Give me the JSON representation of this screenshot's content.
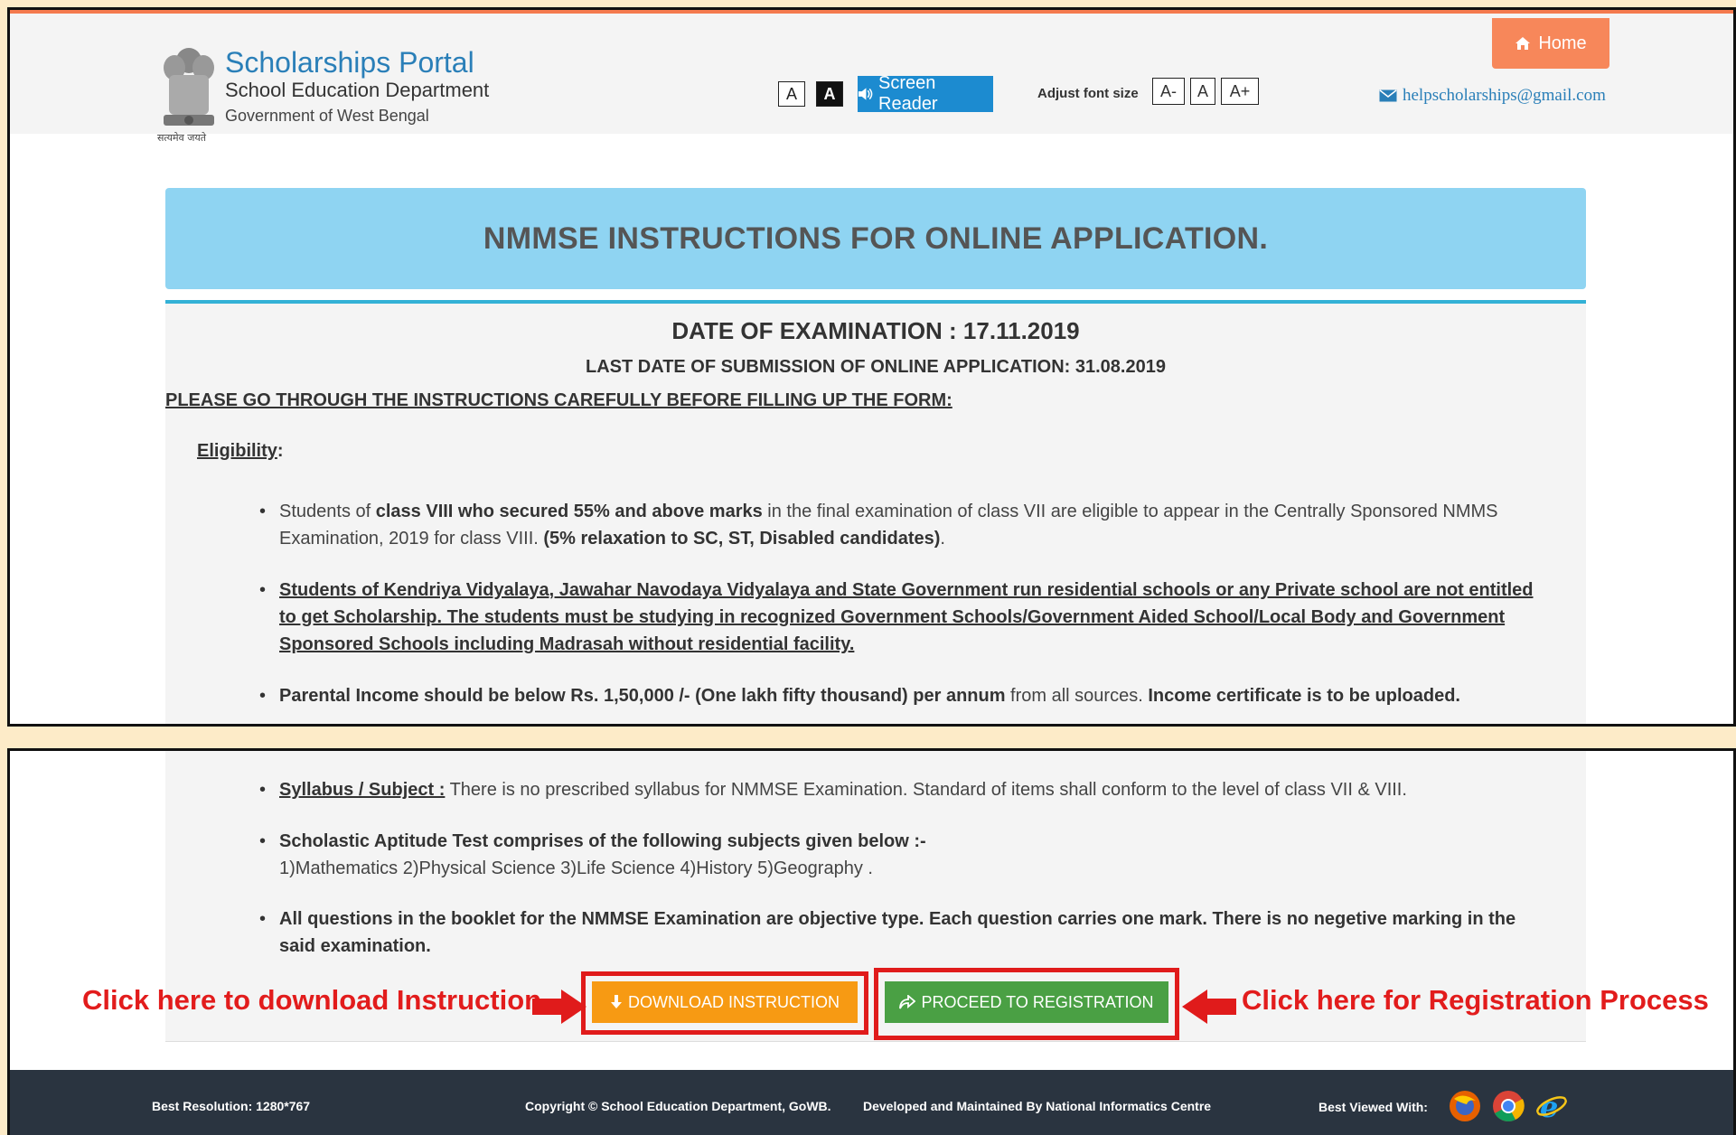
{
  "header": {
    "portal_title": "Scholarships Portal",
    "department": "School Education Department",
    "government": "Government of West Bengal",
    "motto": "सत्यमेव जयते",
    "contrast_normal": "A",
    "contrast_dark": "A",
    "screen_reader_label": "Screen Reader",
    "adjust_font_label": "Adjust font size",
    "font_decrease": "A-",
    "font_normal": "A",
    "font_increase": "A+",
    "home_label": "Home",
    "email": "helpscholarships@gmail.com"
  },
  "main": {
    "banner_title": "NMMSE INSTRUCTIONS FOR ONLINE APPLICATION.",
    "exam_date": "DATE OF EXAMINATION : 17.11.2019",
    "last_date": "LAST DATE OF SUBMISSION OF ONLINE APPLICATION: 31.08.2019",
    "please_read": "PLEASE GO THROUGH THE INSTRUCTIONS CAREFULLY BEFORE FILLING UP THE FORM:",
    "eligibility_label": "Eligibility",
    "eligibility_colon": ":",
    "bullet1": {
      "t1": "Students of ",
      "b1": "class VIII who secured 55% and above marks",
      "t2": " in the final examination of class VII are eligible to appear in the Centrally Sponsored NMMS Examination, 2019 for class VIII. ",
      "b2": "(5% relaxation to SC, ST, Disabled candidates)",
      "t3": "."
    },
    "bullet2": "Students of Kendriya Vidyalaya, Jawahar Navodaya Vidyalaya and State Government run residential schools or any Private school are not entitled to get Scholarship. The students must be studying in recognized Government Schools/Government Aided School/Local Body and Government Sponsored Schools including Madrasah without residential facility.",
    "bullet3": {
      "b1": "Parental Income should be below Rs. 1,50,000 /- (One lakh fifty thousand) per annum",
      "t1": " from all sources. ",
      "b2": "Income certificate is to be uploaded."
    },
    "bullet4": {
      "label": "Syllabus / Subject :",
      "text": " There is no prescribed syllabus for NMMSE Examination. Standard of items shall conform to the level of class VII & VIII."
    },
    "bullet5": {
      "bold": "Scholastic Aptitude Test comprises of the following subjects given below :-",
      "subjects": "1)Mathematics 2)Physical Science 3)Life Science 4)History 5)Geography ."
    },
    "bullet6": "All questions in the booklet for the NMMSE Examination are objective type. Each question carries one mark. There is no negetive marking in the said examination."
  },
  "actions": {
    "download_label": "DOWNLOAD INSTRUCTION",
    "register_label": "PROCEED TO REGISTRATION",
    "note_download": "Click here to download Instruction",
    "note_register": "Click here for Registration Process"
  },
  "footer": {
    "resolution": "Best Resolution: 1280*767",
    "copyright": "Copyright © School Education Department, GoWB.",
    "developed": "Developed and Maintained By National Informatics Centre",
    "best_viewed": "Best Viewed With:"
  },
  "colors": {
    "accent_blue": "#1c8bd0",
    "banner": "#8fd4f2",
    "home": "#f7875a",
    "download": "#f79a13",
    "register": "#4aa044",
    "annotation_red": "#e21c1c",
    "footer_bg": "#2a3440"
  },
  "icons": [
    "emblem-icon",
    "speaker-icon",
    "home-icon",
    "mail-icon",
    "download-arrow-icon",
    "share-icon",
    "firefox-icon",
    "chrome-icon",
    "ie-icon",
    "red-arrow-icon"
  ]
}
